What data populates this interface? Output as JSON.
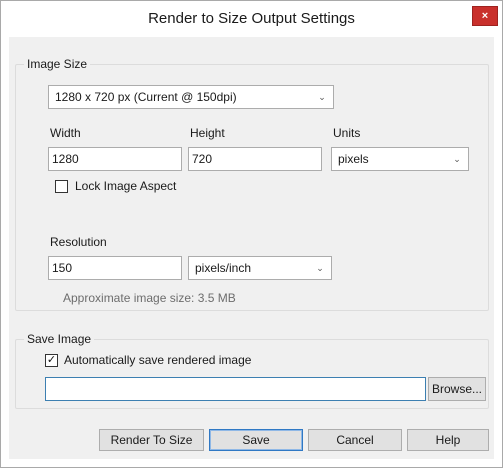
{
  "window": {
    "title": "Render to Size Output Settings",
    "close_glyph": "×"
  },
  "image_size_group": {
    "label": "Image Size",
    "preset_value": "1280 x 720 px (Current @ 150dpi)",
    "width_label": "Width",
    "width_value": "1280",
    "height_label": "Height",
    "height_value": "720",
    "units_label": "Units",
    "units_value": "pixels",
    "lock_aspect_label": "Lock Image Aspect",
    "lock_aspect_checked": false,
    "resolution_label": "Resolution",
    "resolution_value": "150",
    "resolution_units_value": "pixels/inch",
    "approx_size_text": "Approximate image size: 3.5 MB"
  },
  "save_image_group": {
    "label": "Save Image",
    "auto_save_label": "Automatically save rendered image",
    "auto_save_checked": true,
    "path_value": "",
    "browse_label": "Browse..."
  },
  "buttons": {
    "render_to_size": "Render To Size",
    "save": "Save",
    "cancel": "Cancel",
    "help": "Help"
  },
  "icons": {
    "close": "close-icon",
    "dropdown": "chevron-down-icon",
    "check": "checkmark-icon"
  },
  "colors": {
    "close_button": "#c9302c",
    "default_button_border": "#2f78c4",
    "dialog_background": "#f0f0f0"
  }
}
